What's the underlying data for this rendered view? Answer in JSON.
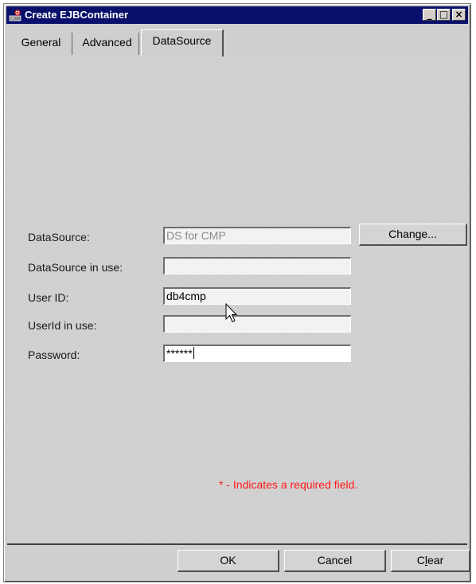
{
  "window": {
    "title": "Create EJBContainer",
    "controls": {
      "minimize": "_",
      "maximize": "□",
      "close": "×"
    }
  },
  "tabs": [
    {
      "label": "General",
      "active": false
    },
    {
      "label": "Advanced",
      "active": false
    },
    {
      "label": "DataSource",
      "active": true
    }
  ],
  "form": {
    "datasource": {
      "label": "DataSource:",
      "value": "DS for CMP",
      "enabled": false
    },
    "change_button": "Change...",
    "datasource_in_use": {
      "label": "DataSource in use:",
      "value": ""
    },
    "user_id": {
      "label": "User ID:",
      "value": "db4cmp"
    },
    "userid_in_use": {
      "label": "UserId in use:",
      "value": ""
    },
    "password": {
      "label": "Password:",
      "value": "******"
    },
    "required_note": "* - Indicates a required field."
  },
  "buttons": {
    "ok": "OK",
    "cancel": "Cancel",
    "clear": "Clear",
    "clear_mnemonic": "l"
  },
  "colors": {
    "titlebar": "#08106b",
    "panel": "#cccccc",
    "required_text": "#ff1a1a",
    "disabled_text": "#8a8a8a"
  },
  "icons": [
    "app-icon",
    "minimize-icon",
    "maximize-icon",
    "close-icon",
    "mouse-pointer-icon"
  ]
}
